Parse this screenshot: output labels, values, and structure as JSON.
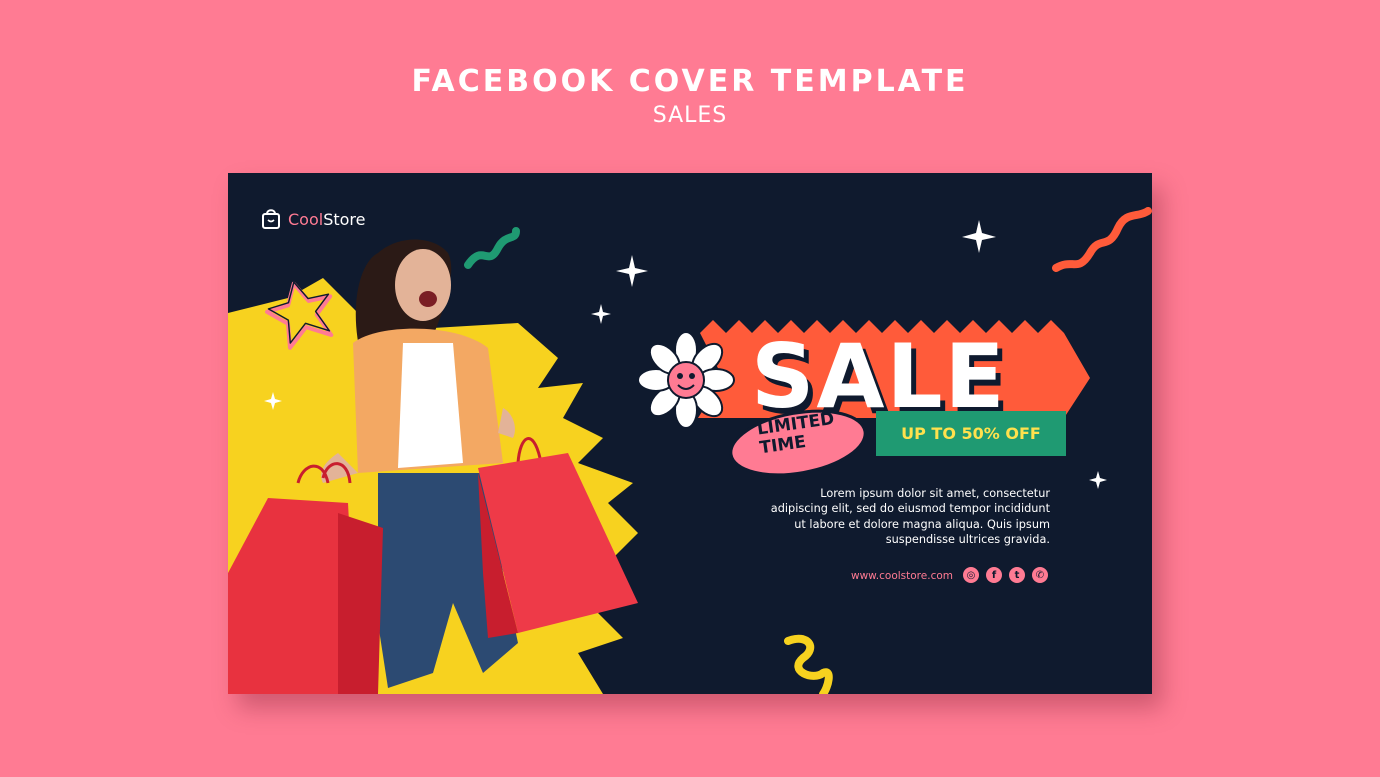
{
  "header": {
    "title": "FACEBOOK COVER TEMPLATE",
    "subtitle": "SALES"
  },
  "cover": {
    "brand_part1": "Cool",
    "brand_part2": "Store",
    "sale_word": "SALE",
    "limited_line1": "LIMITED",
    "limited_line2": "TIME",
    "offer": "UP TO 50% OFF",
    "description_lines": [
      "Lorem ipsum dolor sit amet, consectetur",
      "adipiscing elit, sed do eiusmod tempor incididunt",
      "ut labore et dolore magna aliqua. Quis ipsum",
      "suspendisse ultrices gravida."
    ],
    "url": "www.coolstore.com",
    "socials": [
      {
        "icon": "instagram-icon",
        "glyph": "◎"
      },
      {
        "icon": "facebook-icon",
        "glyph": "f"
      },
      {
        "icon": "twitter-icon",
        "glyph": "t"
      },
      {
        "icon": "whatsapp-icon",
        "glyph": "✆"
      }
    ]
  },
  "colors": {
    "background": "#ff7b93",
    "cover": "#0f1a2e",
    "yellow": "#f7d21f",
    "pink": "#ff7b93",
    "orange": "#ff5b3a",
    "green": "#1f9a72"
  }
}
